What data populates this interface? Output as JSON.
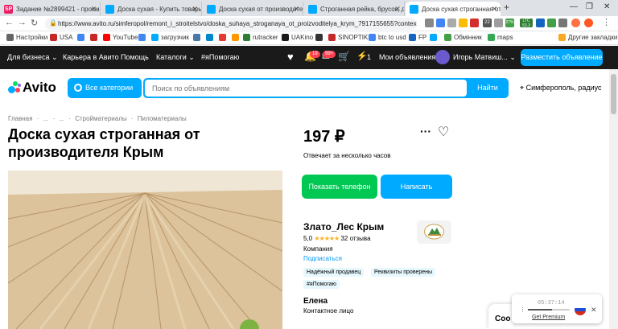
{
  "browser": {
    "tabs": [
      {
        "title": "Задание №2899421 - просмо",
        "favicon": "SP",
        "color": "#e91e63"
      },
      {
        "title": "Доска сухая - Купить товары",
        "favicon": "A",
        "color": "#00aaff"
      },
      {
        "title": "Доска сухая от производите",
        "favicon": "A",
        "color": "#00aaff"
      },
      {
        "title": "Строганная рейка, брусок, до",
        "favicon": "A",
        "color": "#00aaff"
      },
      {
        "title": "Доска сухая строганная от пр",
        "favicon": "A",
        "color": "#00aaff"
      }
    ],
    "url": "https://www.avito.ru/simferopol/remont_i_stroitelstvo/doska_suhaya_stroganaya_ot_proizvoditelya_krym_7917155655?contex...",
    "new_tab": "+",
    "ext_labels": {
      "ltc": "LTC",
      "ltc_val": "53.3",
      "count": "22",
      "pct": "27%"
    },
    "bookmarks": [
      {
        "label": "Настройки",
        "color": "#666"
      },
      {
        "label": "USA",
        "color": "#c62828"
      },
      {
        "label": "",
        "color": "#4285f4"
      },
      {
        "label": "",
        "color": "#c62828"
      },
      {
        "label": "YouTube",
        "color": "#ff0000"
      },
      {
        "label": "",
        "color": "#4285f4"
      },
      {
        "label": "загрузчик",
        "color": "#00aaff"
      },
      {
        "label": "",
        "color": "#4a76a8"
      },
      {
        "label": "",
        "color": "#0088cc"
      },
      {
        "label": "",
        "color": "#e53935"
      },
      {
        "label": "",
        "color": "#ff9800"
      },
      {
        "label": "rutracker",
        "color": "#2e7d32"
      },
      {
        "label": "UAKino",
        "color": "#1a1a1a"
      },
      {
        "label": "",
        "color": "#333"
      },
      {
        "label": "SINOPTIK",
        "color": "#c62828"
      },
      {
        "label": "btc to usd",
        "color": "#4285f4"
      },
      {
        "label": "FP",
        "color": "#1565c0"
      },
      {
        "label": "",
        "color": "#00aaff"
      },
      {
        "label": "Обмінник",
        "color": "#43a047"
      },
      {
        "label": "maps",
        "color": "#34a853"
      },
      {
        "label": "Другие закладки",
        "color": "#f9a825"
      }
    ]
  },
  "topnav": {
    "business": "Для бизнеса",
    "career": "Карьера в Авито",
    "help": "Помощь",
    "catalogs": "Каталоги",
    "hashtag": "#яПомогаю",
    "bell_badge": "19",
    "msg_badge": "99+",
    "cart_count": "1",
    "my_ads": "Мои объявления",
    "user": "Игорь Матвиш...",
    "post_ad": "Разместить объявление"
  },
  "search": {
    "logo": "Avito",
    "categories": "Все категории",
    "placeholder": "Поиск по объявлениям",
    "button": "Найти",
    "location": "Симферополь, радиус"
  },
  "breadcrumbs": [
    "Главная",
    "·",
    "...",
    "·",
    "...",
    "·",
    "Стройматериалы",
    "·",
    "Пиломатериалы"
  ],
  "listing": {
    "title": "Доска сухая строганная от производителя Крым",
    "price": "197 ₽",
    "responds": "Отвечает за несколько часов",
    "show_phone": "Показать телефон",
    "write": "Написать"
  },
  "seller": {
    "name": "Злато_Лес Крым",
    "rating": "5,0",
    "stars": "★★★★★",
    "reviews": "32 отзыва",
    "type": "Компания",
    "subscribe": "Подписаться",
    "tags": [
      "Надёжный продавец",
      "Реквизиты проверены",
      "#яПомогаю"
    ],
    "contact_name": "Елена",
    "contact_role": "Контактное лицо"
  },
  "vpn": {
    "time": "05:37:14",
    "premium": "Get Premium"
  },
  "chat": {
    "label": "Coo"
  }
}
